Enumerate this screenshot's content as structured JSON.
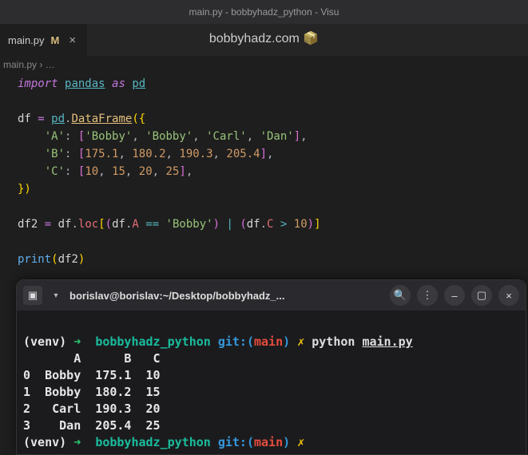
{
  "window": {
    "title": "main.py - bobbyhadz_python - Visu"
  },
  "tab": {
    "name": "main.py",
    "modified": "M",
    "close": "×"
  },
  "watermark": {
    "text": "bobbyhadz.com",
    "emoji": "📦"
  },
  "breadcrumb": {
    "file": "main.py",
    "sep": "›",
    "more": "…"
  },
  "code": {
    "l1": {
      "kw": "import",
      "mod": "pandas",
      "as": "as",
      "alias": "pd"
    },
    "l3": {
      "var": "df",
      "eq": "=",
      "pd": "pd",
      "dot": ".",
      "df": "DataFrame",
      "open": "({"
    },
    "l4": {
      "key": "'A'",
      "colon": ":",
      "ob": "[",
      "v1": "'Bobby'",
      "c": ",",
      "v2": "'Bobby'",
      "v3": "'Carl'",
      "v4": "'Dan'",
      "cb": "]"
    },
    "l5": {
      "key": "'B'",
      "colon": ":",
      "ob": "[",
      "v1": "175.1",
      "c": ",",
      "v2": "180.2",
      "v3": "190.3",
      "v4": "205.4",
      "cb": "]"
    },
    "l6": {
      "key": "'C'",
      "colon": ":",
      "ob": "[",
      "v1": "10",
      "c": ",",
      "v2": "15",
      "v3": "20",
      "v4": "25",
      "cb": "]"
    },
    "l7": {
      "close": "})"
    },
    "l9": {
      "var": "df2",
      "eq": "=",
      "df": "df",
      "dot": ".",
      "loc": "loc",
      "ob": "[",
      "op1": "(",
      "dfA": "df",
      "dotA": ".",
      "A": "A",
      "eqeq": "==",
      "bobby": "'Bobby'",
      "cp1": ")",
      "or": "|",
      "op2": "(",
      "dfC": "df",
      "dotC": ".",
      "C": "C",
      "gt": ">",
      "ten": "10",
      "cp2": ")",
      "cb": "]"
    },
    "l11": {
      "print": "print",
      "op": "(",
      "arg": "df2",
      "cp": ")"
    }
  },
  "terminal": {
    "title": "borislav@borislav:~/Desktop/bobbyhadz_...",
    "prompt1": {
      "venv": "(venv)",
      "arrow": "➜",
      "cwd": "bobbyhadz_python",
      "git": "git:(",
      "branch": "main",
      "gitc": ")",
      "flash": "✗",
      "cmd": "python",
      "arg": "main.py"
    },
    "headers": "       A      B   C",
    "row0": "0  Bobby  175.1  10",
    "row1": "1  Bobby  180.2  15",
    "row2": "2   Carl  190.3  20",
    "row3": "3    Dan  205.4  25",
    "prompt2": {
      "venv": "(venv)",
      "arrow": "➜",
      "cwd": "bobbyhadz_python",
      "git": "git:(",
      "branch": "main",
      "gitc": ")",
      "flash": "✗"
    }
  },
  "chart_data": {
    "type": "table",
    "title": "df2 output",
    "columns": [
      "",
      "A",
      "B",
      "C"
    ],
    "rows": [
      [
        0,
        "Bobby",
        175.1,
        10
      ],
      [
        1,
        "Bobby",
        180.2,
        15
      ],
      [
        2,
        "Carl",
        190.3,
        20
      ],
      [
        3,
        "Dan",
        205.4,
        25
      ]
    ]
  }
}
